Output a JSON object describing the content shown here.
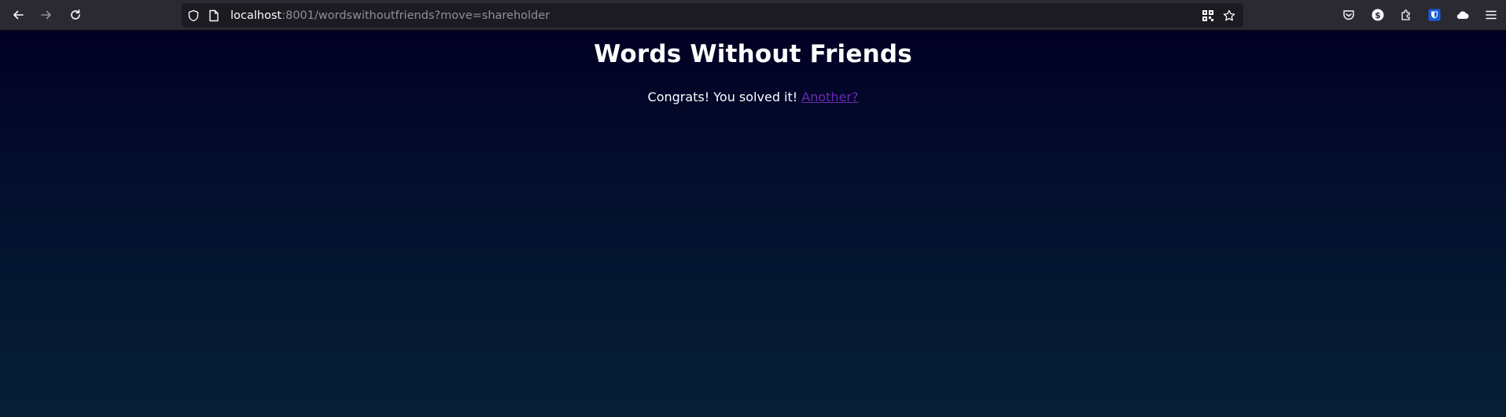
{
  "browser": {
    "url_host": "localhost",
    "url_rest": ":8001/wordswithoutfriends?move=shareholder",
    "icons": {
      "back": "back-arrow-icon",
      "forward": "forward-arrow-icon",
      "reload": "reload-icon",
      "tracking": "shield-icon",
      "page_info": "page-icon",
      "qr": "qr-code-icon",
      "bookmark": "star-icon",
      "pocket": "pocket-icon",
      "account": "dollar-circle-icon",
      "extensions": "puzzle-icon",
      "bitwarden": "bitwarden-shield-icon",
      "extension_2": "cloud-extension-icon",
      "menu": "hamburger-menu-icon"
    }
  },
  "page": {
    "title": "Words Without Friends",
    "message": "Congrats! You solved it!",
    "link_label": "Another?",
    "colors": {
      "background_top": "#020024",
      "background_bottom": "#071f36",
      "link": "#6a2bb6"
    }
  }
}
